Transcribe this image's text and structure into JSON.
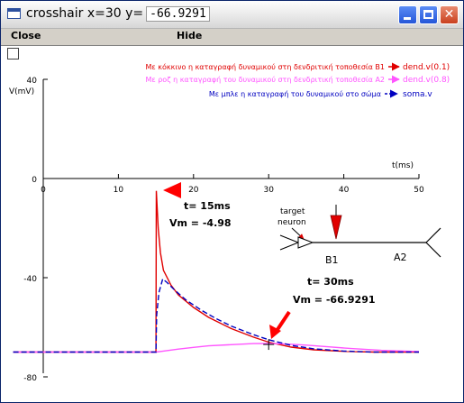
{
  "window": {
    "title_label": "crosshair x=30 y=",
    "title_value": "-66.9291",
    "minimize": "minimize",
    "maximize": "maximize",
    "close_glyph": "✕"
  },
  "menu": {
    "close_label": "Close",
    "hide_label": "Hide"
  },
  "legend": [
    {
      "text": "Με κόκκινο η καταγραφή δυναμικού στη δενδριτική τοποθεσία Β1",
      "series": "dend.v(0.1)",
      "color": "#e00000"
    },
    {
      "text": "Με ροζ η καταγραφή του δυναμικού στη δενδριτική τοποθεσία Α2",
      "series": "dend.v(0.8)",
      "color": "#ff55ff"
    },
    {
      "text": "Με μπλε η καταγραφή του δυναμικού στο σώμα",
      "series": "soma.v",
      "color": "#0000c0"
    }
  ],
  "annotations": {
    "peak_time": "t= 15ms",
    "peak_vm": "Vm = -4.98",
    "cross_time": "t= 30ms",
    "cross_vm": "Vm = -66.9291",
    "target_label_1": "target",
    "target_label_2": "neuron",
    "b1_label": "B1",
    "a2_label": "A2"
  },
  "colors": {
    "red": "#e00000",
    "pink": "#ff55ff",
    "blue": "#0000c0",
    "arrow": "#ff0000"
  },
  "chart_data": {
    "type": "line",
    "xlabel": "t(ms)",
    "ylabel": "V(mV)",
    "xlim": [
      0,
      50
    ],
    "ylim": [
      -80,
      40
    ],
    "xticks": [
      0,
      10,
      20,
      30,
      40,
      50
    ],
    "yticks": [
      40,
      0,
      -40,
      -80
    ],
    "t_end": 50,
    "crosshair": {
      "x": 30,
      "y": -66.9291
    },
    "series": [
      {
        "name": "dend.v(0.1)",
        "color": "#e00000",
        "points": [
          [
            -4,
            -70
          ],
          [
            15,
            -70
          ],
          [
            15.05,
            -4.98
          ],
          [
            15.3,
            -20
          ],
          [
            15.6,
            -30
          ],
          [
            16,
            -37
          ],
          [
            17,
            -43
          ],
          [
            18,
            -47
          ],
          [
            20,
            -52
          ],
          [
            22,
            -56
          ],
          [
            25,
            -60.5
          ],
          [
            28,
            -64
          ],
          [
            30,
            -66
          ],
          [
            33,
            -68
          ],
          [
            36,
            -69.1
          ],
          [
            40,
            -69.7
          ],
          [
            44,
            -70
          ],
          [
            50,
            -70
          ]
        ]
      },
      {
        "name": "dend.v(0.8)",
        "color": "#ff55ff",
        "points": [
          [
            -4,
            -70
          ],
          [
            15,
            -70
          ],
          [
            16,
            -69.6
          ],
          [
            18,
            -68.8
          ],
          [
            20,
            -68.1
          ],
          [
            22,
            -67.5
          ],
          [
            25,
            -67.0
          ],
          [
            28,
            -66.6
          ],
          [
            30,
            -66.5
          ],
          [
            32,
            -66.7
          ],
          [
            35,
            -67.2
          ],
          [
            38,
            -67.9
          ],
          [
            41,
            -68.6
          ],
          [
            45,
            -69.3
          ],
          [
            50,
            -69.8
          ]
        ]
      },
      {
        "name": "soma.v",
        "color": "#0000c0",
        "points": [
          [
            -4,
            -70
          ],
          [
            15,
            -70
          ],
          [
            15.1,
            -55
          ],
          [
            15.4,
            -46
          ],
          [
            15.9,
            -40.5
          ],
          [
            16.5,
            -42
          ],
          [
            17.5,
            -45
          ],
          [
            19,
            -49
          ],
          [
            21,
            -53
          ],
          [
            23,
            -56.5
          ],
          [
            25,
            -59.5
          ],
          [
            28,
            -63
          ],
          [
            30,
            -65
          ],
          [
            33,
            -67.3
          ],
          [
            36,
            -68.7
          ],
          [
            40,
            -69.6
          ],
          [
            44,
            -70
          ],
          [
            50,
            -70
          ]
        ]
      }
    ]
  }
}
